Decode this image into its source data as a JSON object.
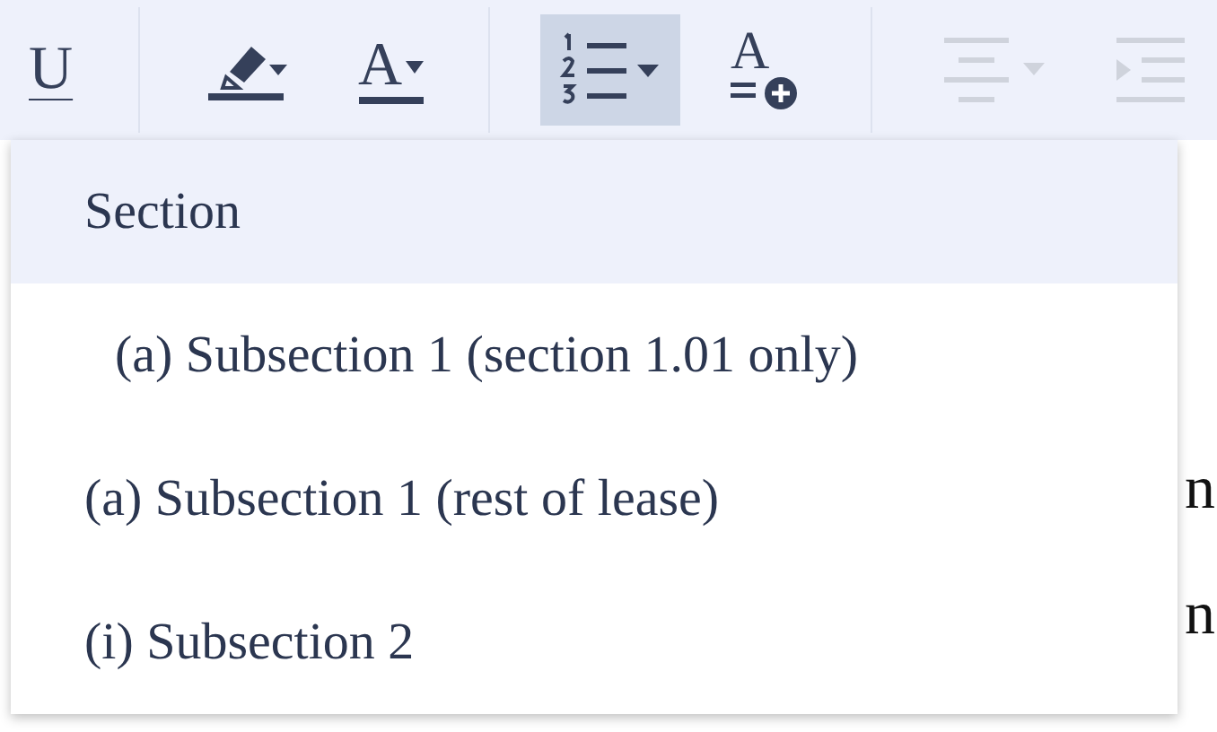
{
  "toolbar": {
    "tools": [
      {
        "kind": "underline",
        "label": "U",
        "selected": false,
        "disabled": false
      },
      {
        "kind": "divider"
      },
      {
        "kind": "highlight",
        "selected": false,
        "disabled": false
      },
      {
        "kind": "textcolor",
        "label": "A",
        "selected": false,
        "disabled": false
      },
      {
        "kind": "divider"
      },
      {
        "kind": "numbered",
        "selected": true,
        "disabled": false
      },
      {
        "kind": "addstyle",
        "label": "A",
        "selected": false,
        "disabled": false
      },
      {
        "kind": "divider"
      },
      {
        "kind": "align",
        "selected": false,
        "disabled": true
      },
      {
        "kind": "indent",
        "selected": false,
        "disabled": true
      }
    ]
  },
  "document": {
    "fragments": [
      "n",
      "n"
    ]
  },
  "menu": {
    "items": [
      {
        "label": "Section",
        "selected": true,
        "indented": false
      },
      {
        "label": "(a) Subsection 1 (section 1.01 only)",
        "selected": false,
        "indented": true
      },
      {
        "label": "(a) Subsection 1 (rest of lease)",
        "selected": false,
        "indented": false
      },
      {
        "label": "(i) Subsection 2",
        "selected": false,
        "indented": false
      }
    ]
  }
}
